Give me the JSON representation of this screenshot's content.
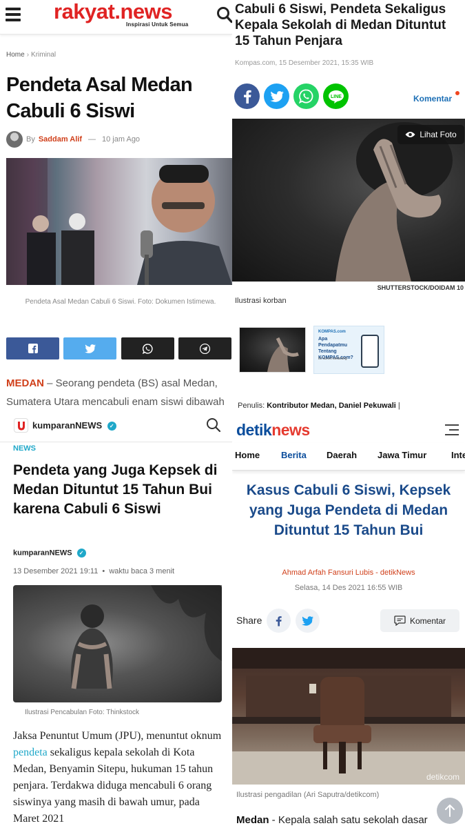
{
  "rakyat": {
    "logo": "rakyat.news",
    "tagline": "Inspirasi Untuk Semua",
    "breadcrumb": {
      "home": "Home",
      "sep": "›",
      "category": "Kriminal"
    },
    "title": "Pendeta Asal Medan Cabuli 6 Siswi",
    "byline": {
      "by": "By",
      "author": "Saddam Alif",
      "dash": "—",
      "time": "10 jam Ago"
    },
    "caption": "Pendeta Asal Medan Cabuli 6 Siswi. Foto: Dokumen Istimewa.",
    "lead_place": "MEDAN",
    "lead_text": " – Seorang pendeta (BS) asal Medan, Sumatera Utara mencabuli enam siswi dibawah",
    "share_colors": {
      "facebook": "#3b5998",
      "twitter": "#55acee",
      "whatsapp": "#222222",
      "telegram": "#222222"
    }
  },
  "kompas": {
    "title": "Cabuli 6 Siswi, Pendeta Sekaligus Kepala Sekolah di Medan Dituntut 15 Tahun Penjara",
    "meta": "Kompas.com, 15 Desember 2021, 15:35 WIB",
    "komentar": "Komentar",
    "lihat_foto": "Lihat Foto",
    "photo_credit": "SHUTTERSTOCK/DOIDAM 10",
    "photo_caption": "Ilustrasi korban",
    "ad": {
      "logo": "KOMPAS.com",
      "text": "Apa Pendapatmu Tentang KOMPAS.com?",
      "small": "Isi survei sekarang"
    },
    "penulis_label": "Penulis:",
    "penulis_name": "Kontributor Medan, Daniel Pekuwali",
    "penulis_sep": "|",
    "social_colors": {
      "facebook": "#3b5998",
      "twitter": "#1da1f2",
      "whatsapp": "#25d366",
      "line": "#00c300"
    }
  },
  "kumparan": {
    "brand": "kumparanNEWS",
    "category": "NEWS",
    "title": "Pendeta yang Juga Kepsek di Medan Dituntut 15 Tahun Bui karena Cabuli 6 Siswi",
    "author": "kumparanNEWS",
    "date": "13 Desember 2021 19:11",
    "read_time": "waktu baca 3 menit",
    "caption": "Ilustrasi Pencabulan Foto: Thinkstock",
    "body_1": "Jaksa Penuntut Umum (JPU), menuntut oknum ",
    "body_link": "pendeta",
    "body_2": " sekaligus kepala sekolah di Kota Medan, Benyamin Sitepu, hukuman 15 tahun penjara. Terdakwa diduga mencabuli 6 orang siswinya yang masih di bawah umur, pada Maret 2021",
    "accent": "#1fa8c9"
  },
  "detik": {
    "logo_a": "detik",
    "logo_b": "news",
    "nav": [
      "Home",
      "Berita",
      "Daerah",
      "Jawa Timur",
      "Inte"
    ],
    "title": "Kasus Cabuli 6 Siswi, Kepsek yang Juga Pendeta di Medan Dituntut 15 Tahun Bui",
    "author": "Ahmad Arfah Fansuri Lubis - detikNews",
    "date": "Selasa, 14 Des 2021 16:55 WIB",
    "share": "Share",
    "komentar": "Komentar",
    "watermark": "detikcom",
    "caption": "Ilustrasi pengadilan (Ari Saputra/detikcom)",
    "lead_place": "Medan",
    "lead_text": " - Kepala salah satu sekolah dasar"
  }
}
